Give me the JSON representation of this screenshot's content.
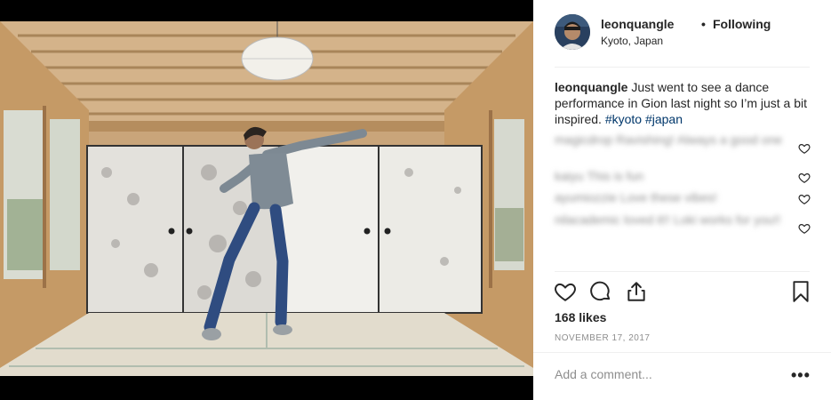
{
  "post": {
    "username": "leonquangle",
    "separator": "•",
    "follow_status": "Following",
    "location": "Kyoto, Japan",
    "caption_user": "leonquangle",
    "caption_text": "Just went to see a dance performance in Gion last night so I’m just a bit inspired.",
    "hashtag_1": "#kyoto",
    "hashtag_2": "#japan",
    "likes": "168 likes",
    "date": "NOVEMBER 17, 2017",
    "add_comment_placeholder": "Add a comment...",
    "more_options": "•••"
  },
  "comments": [
    {
      "text": "magicdrop Ravishing! Always a good one"
    },
    {
      "text": "kaiyu This is fun"
    },
    {
      "text": "ayumiozzie Love these vibes!"
    },
    {
      "text": "nilacademic loved it!! Loki works for you!!"
    }
  ],
  "icons": {
    "like": "heart-icon",
    "comment": "comment-bubble-icon",
    "share": "share-icon",
    "save": "bookmark-icon",
    "comment_like": "heart-icon"
  },
  "colors": {
    "text": "#262626",
    "muted": "#8e8e8e",
    "hashtag": "#00376b",
    "border": "#efefef"
  }
}
